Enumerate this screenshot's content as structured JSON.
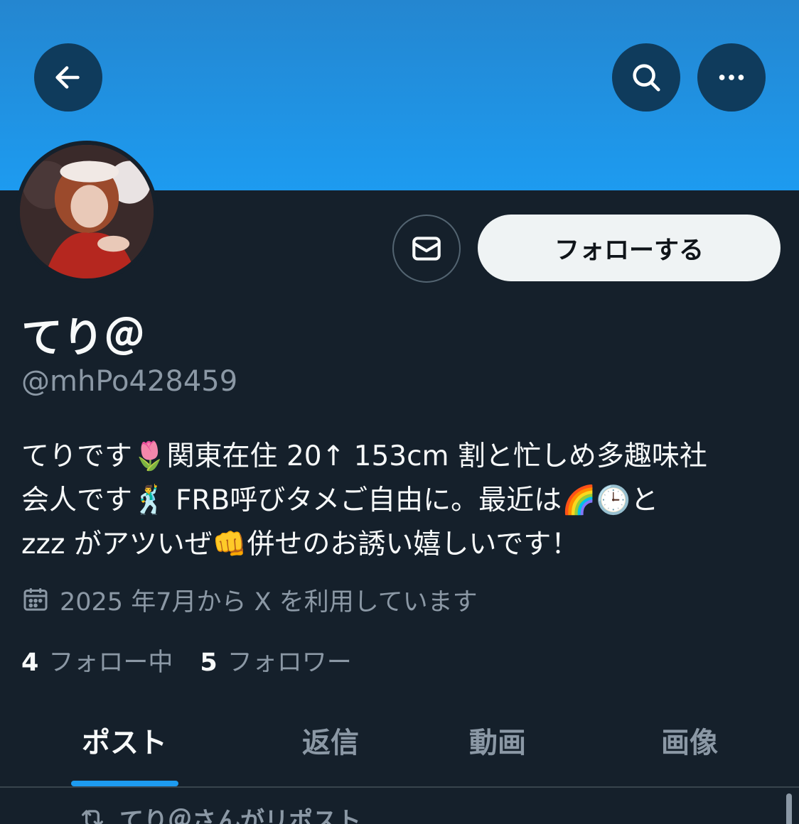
{
  "header": {
    "back_icon": "arrow-left-icon",
    "search_icon": "search-icon",
    "more_icon": "more-horizontal-icon"
  },
  "profile": {
    "display_name": "てり＠",
    "handle": "@mhPo428459",
    "bio_lines": [
      "てりです🌷関東在住 20↑ 153cm 割と忙しめ多趣味社",
      "会人です🕺 FRB呼びタメご自由に。最近は🌈🕒と",
      "zzz がアツいぜ👊併せのお誘い嬉しいです！"
    ],
    "joined": "2025 年7月から X を利用しています",
    "following_count": "4",
    "following_label": "フォロー中",
    "followers_count": "5",
    "followers_label": "フォロワー"
  },
  "actions": {
    "dm_icon": "mail-icon",
    "follow_label": "フォローする"
  },
  "tabs": [
    {
      "label": "ポスト",
      "active": true
    },
    {
      "label": "返信",
      "active": false
    },
    {
      "label": "動画",
      "active": false
    },
    {
      "label": "画像",
      "active": false
    }
  ],
  "timeline": {
    "repost_label": "てり＠さんがリポスト"
  },
  "colors": {
    "accent": "#1d9bf0",
    "background": "#15202b",
    "secondary_text": "#8b98a5"
  }
}
